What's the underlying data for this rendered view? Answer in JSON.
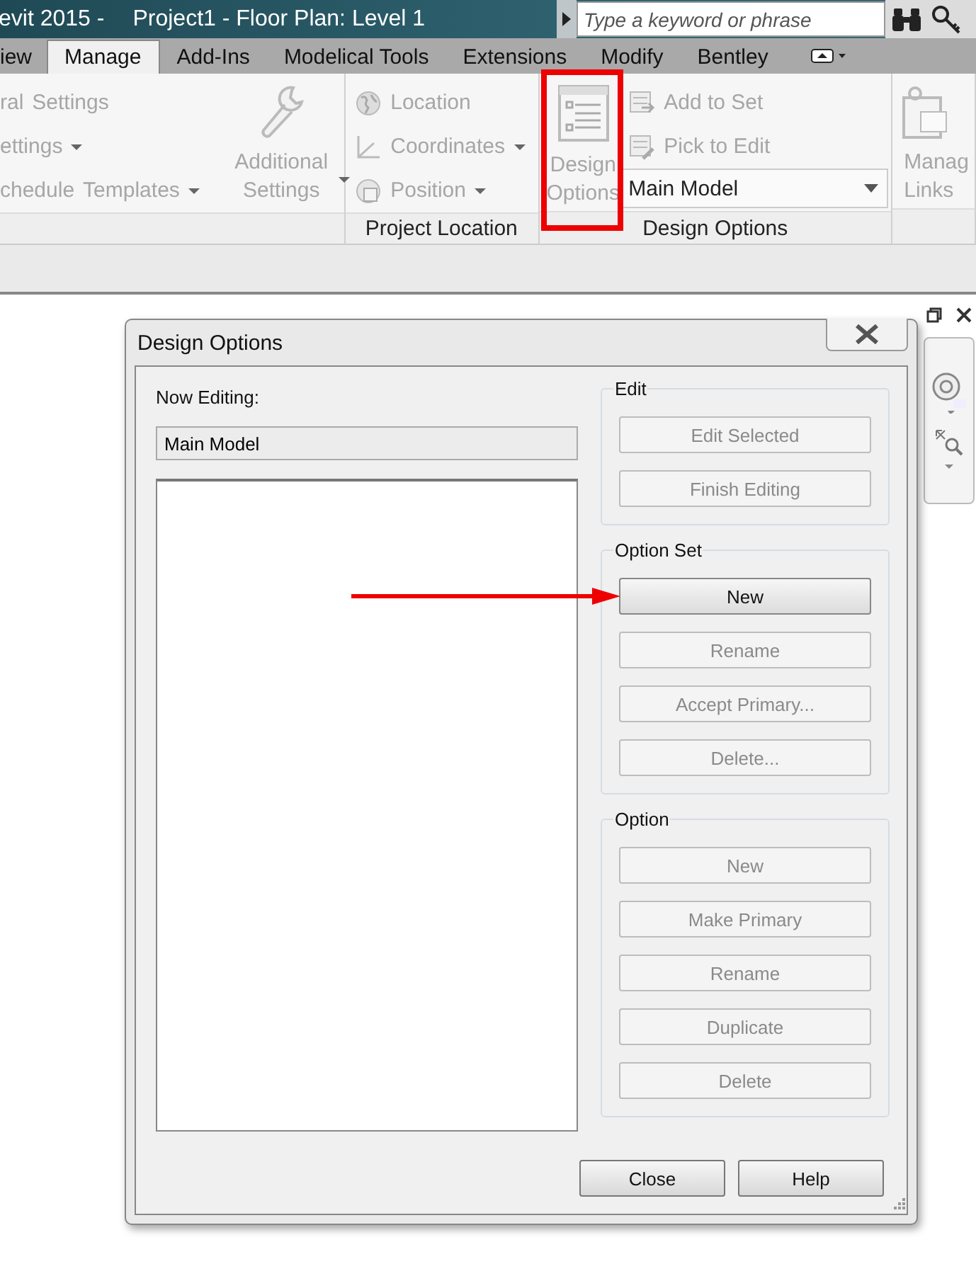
{
  "title_bar": {
    "app_title": "evit 2015 -",
    "document_title": "Project1 - Floor Plan: Level 1",
    "search": {
      "placeholder": "Type a keyword or phrase"
    }
  },
  "tabs": [
    {
      "label": "iew",
      "selected": false
    },
    {
      "label": "Manage",
      "selected": true
    },
    {
      "label": "Add-Ins",
      "selected": false
    },
    {
      "label": "Modelical Tools",
      "selected": false
    },
    {
      "label": "Extensions",
      "selected": false
    },
    {
      "label": "Modify",
      "selected": false
    },
    {
      "label": "Bentley",
      "selected": false
    }
  ],
  "ribbon": {
    "panels": [
      {
        "rows": [
          [
            {
              "label": "ral",
              "has_menu": false
            },
            {
              "label": "Settings",
              "has_menu": false
            }
          ],
          [
            {
              "label": "ettings",
              "has_menu": true
            }
          ],
          [
            {
              "label": "chedule",
              "has_menu": false
            },
            {
              "label": "Templates",
              "has_menu": true
            }
          ]
        ],
        "large_button": {
          "label": "Additional Settings",
          "has_menu": true,
          "disabled": true
        }
      },
      {
        "label": "Project Location",
        "items": [
          {
            "label": "Location",
            "kind": "globe",
            "has_menu": false,
            "disabled": true
          },
          {
            "label": "Coordinates",
            "kind": "axes",
            "has_menu": true,
            "disabled": true
          },
          {
            "label": "Position",
            "kind": "position",
            "has_menu": true,
            "disabled": true
          }
        ]
      },
      {
        "label": "Design Options",
        "large_button": {
          "label": "Design Options",
          "highlighted": true,
          "disabled": true
        },
        "items": [
          {
            "label": "Add to Set",
            "disabled": true
          },
          {
            "label": "Pick to Edit",
            "disabled": true
          }
        ],
        "dropdown": {
          "value": "Main Model"
        }
      },
      {
        "large_button": {
          "label": "Manag Links",
          "disabled": true
        }
      }
    ]
  },
  "dialog": {
    "title": "Design Options",
    "now_editing_label": "Now Editing:",
    "now_editing_value": "Main Model",
    "groups": [
      {
        "title": "Edit",
        "buttons": [
          {
            "label": "Edit Selected",
            "disabled": true,
            "pointed": false
          },
          {
            "label": "Finish Editing",
            "disabled": true,
            "pointed": false
          }
        ]
      },
      {
        "title": "Option Set",
        "buttons": [
          {
            "label": "New",
            "disabled": false,
            "pointed": true
          },
          {
            "label": "Rename",
            "disabled": true,
            "pointed": false
          },
          {
            "label": "Accept Primary...",
            "disabled": true,
            "pointed": false
          },
          {
            "label": "Delete...",
            "disabled": true,
            "pointed": false
          }
        ]
      },
      {
        "title": "Option",
        "buttons": [
          {
            "label": "New",
            "disabled": true,
            "pointed": false
          },
          {
            "label": "Make Primary",
            "disabled": true,
            "pointed": false
          },
          {
            "label": "Rename",
            "disabled": true,
            "pointed": false
          },
          {
            "label": "Duplicate",
            "disabled": true,
            "pointed": false
          },
          {
            "label": "Delete",
            "disabled": true,
            "pointed": false
          }
        ]
      }
    ],
    "footer_buttons": [
      "Close",
      "Help"
    ]
  }
}
